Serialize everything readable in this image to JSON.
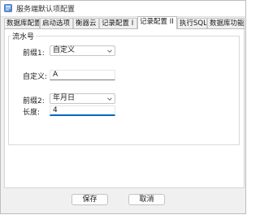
{
  "window": {
    "title": "服务端默认项配置"
  },
  "tabs": [
    {
      "label": "数据库配置",
      "active": false
    },
    {
      "label": "启动选项",
      "active": false
    },
    {
      "label": "衡器云",
      "active": false
    },
    {
      "label": "记录配置 I",
      "active": false
    },
    {
      "label": "记录配置 II",
      "active": true
    },
    {
      "label": "执行SQL",
      "active": false
    },
    {
      "label": "数据库功能",
      "active": false
    }
  ],
  "group": {
    "label": "流水号",
    "prefix1": {
      "label": "前缀1:",
      "value": "自定义"
    },
    "custom": {
      "label": "自定义:",
      "value": "A"
    },
    "prefix2": {
      "label": "前缀2:",
      "value": "年月日"
    },
    "length": {
      "label": "长度:",
      "value": "4"
    }
  },
  "buttons": {
    "save": "保存",
    "cancel": "取消"
  },
  "colors": {
    "accent": "#0067c0",
    "background": "#f0f0f0"
  }
}
